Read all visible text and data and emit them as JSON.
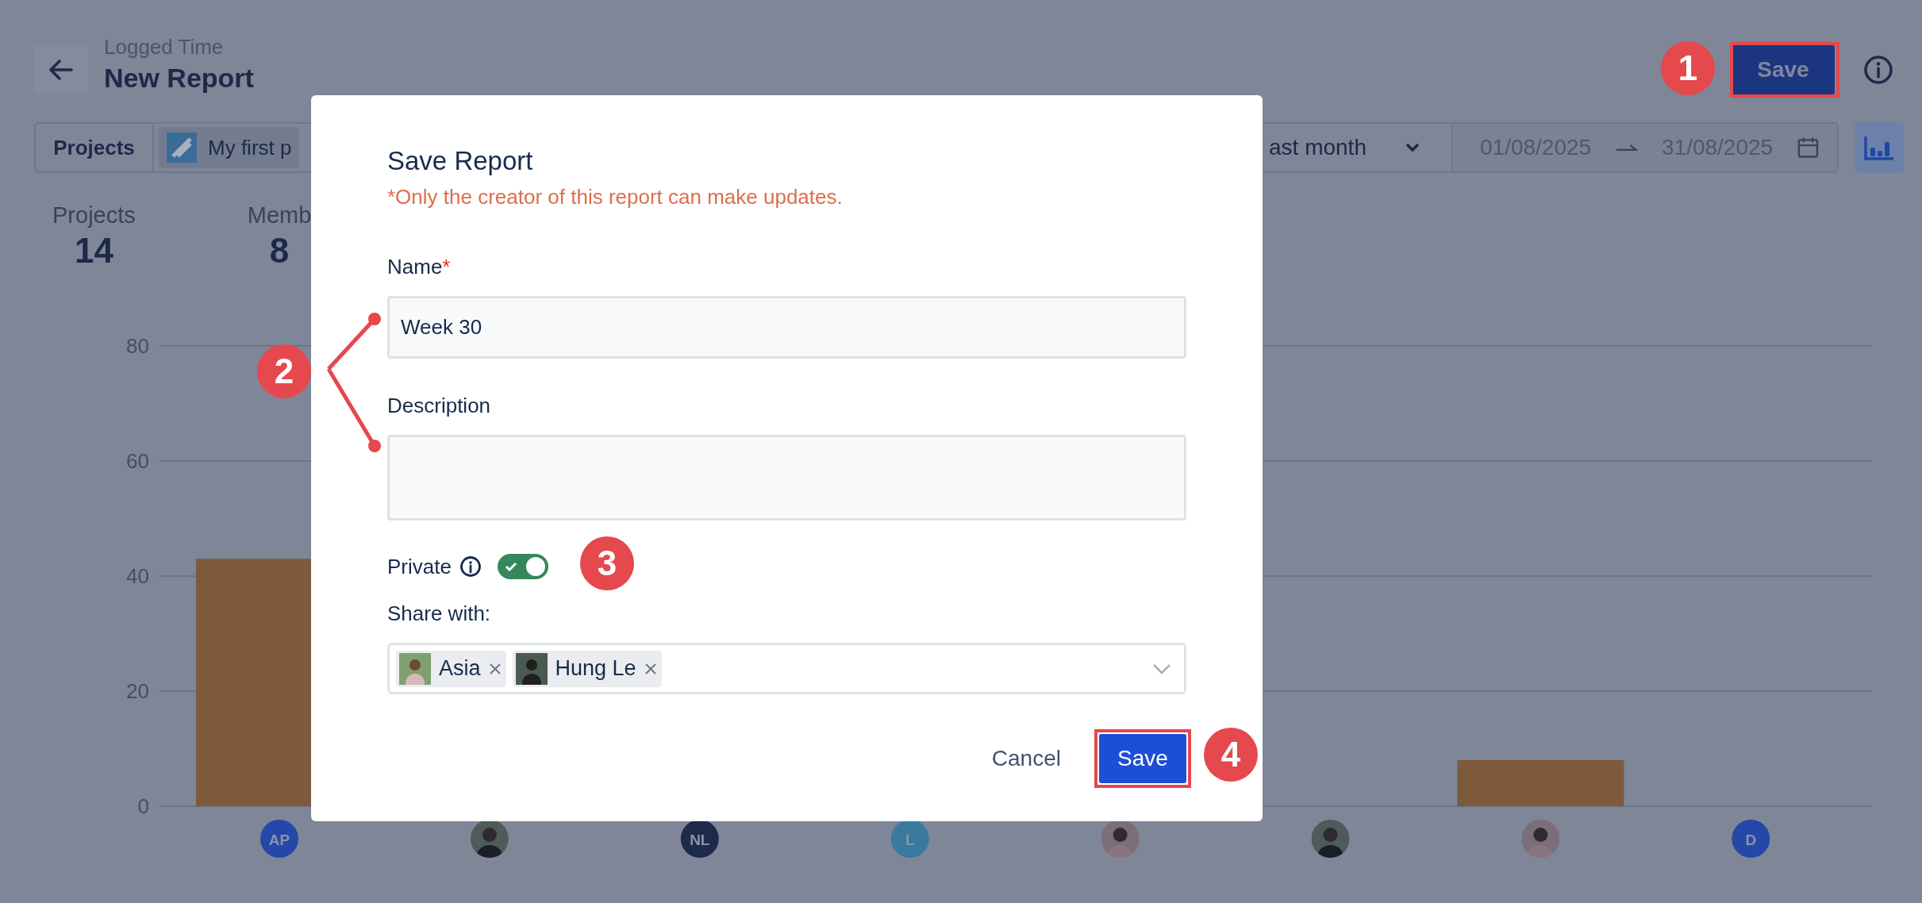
{
  "header": {
    "subtitle": "Logged Time",
    "title": "New Report",
    "save_button": "Save"
  },
  "filters": {
    "label": "Projects",
    "project": "My first p",
    "period": "ast month",
    "date_from": "01/08/2025",
    "date_to": "31/08/2025"
  },
  "stats": [
    {
      "label": "Projects",
      "value": "14"
    },
    {
      "label": "Memb",
      "value": "8"
    }
  ],
  "chart": {
    "chart_data": {
      "type": "bar",
      "grid": true,
      "ylim": [
        0,
        80
      ],
      "yticks": [
        0,
        20,
        40,
        60,
        80
      ],
      "values": [
        43,
        null,
        null,
        null,
        null,
        null,
        8,
        0
      ]
    },
    "avatars": [
      {
        "kind": "initials",
        "text": "AP",
        "color": "#2548a8"
      },
      {
        "kind": "photo"
      },
      {
        "kind": "initials",
        "text": "NL",
        "color": "#1e2a4a"
      },
      {
        "kind": "initials",
        "text": "L",
        "color": "#3a7a9e"
      },
      {
        "kind": "photo"
      },
      {
        "kind": "photo"
      },
      {
        "kind": "photo"
      },
      {
        "kind": "initials",
        "text": "D",
        "color": "#2548a8"
      }
    ]
  },
  "modal": {
    "title": "Save Report",
    "note": "*Only the creator of this report can make updates.",
    "fields": [
      {
        "label": "Name",
        "required_mark": "*",
        "value": "Week 30",
        "kind": "input"
      },
      {
        "label": "Description",
        "kind": "textarea"
      }
    ],
    "private": {
      "label": "Private",
      "on": true
    },
    "share": {
      "label": "Share with:",
      "people": [
        {
          "name": "Asia"
        },
        {
          "name": "Hung Le"
        }
      ]
    },
    "cancel": "Cancel",
    "save": "Save"
  },
  "annotations": [
    {
      "number": "1"
    },
    {
      "number": "2"
    },
    {
      "number": "3"
    },
    {
      "number": "4"
    }
  ]
}
